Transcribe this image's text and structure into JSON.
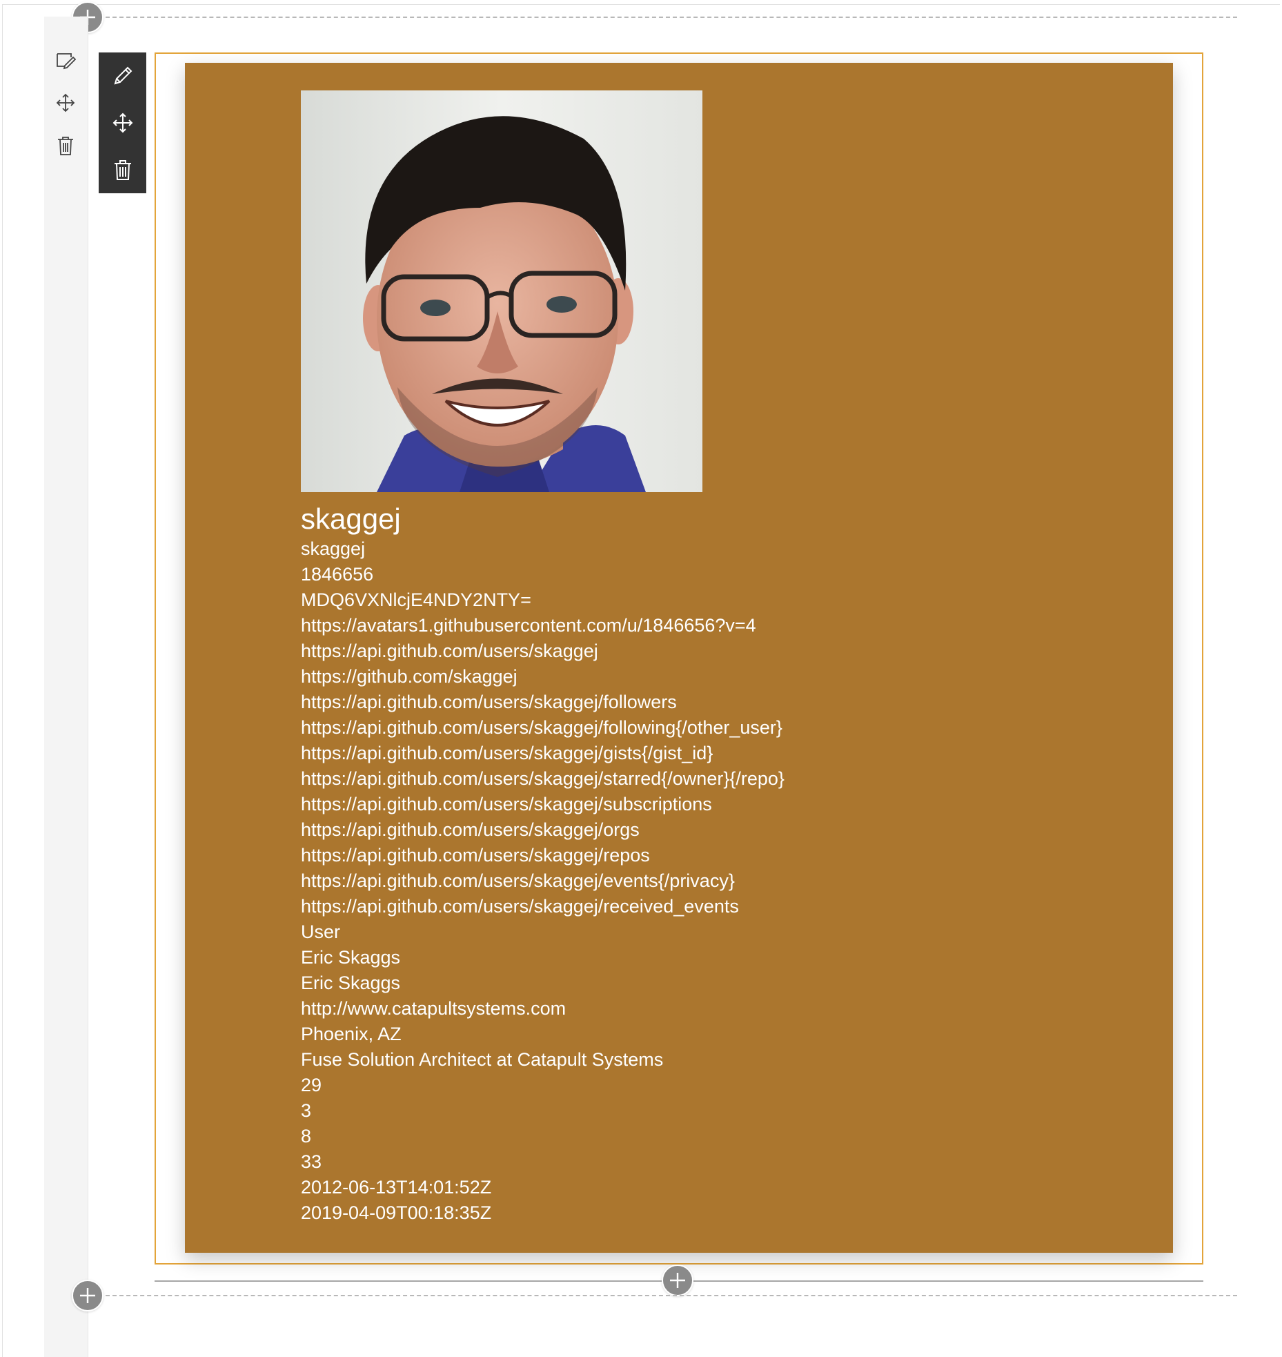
{
  "section_tools": {
    "edit_icon": "edit-section-icon",
    "move_icon": "move-section-icon",
    "delete_icon": "delete-section-icon"
  },
  "webpart_tools": {
    "edit_icon": "pencil-icon",
    "move_icon": "move-icon",
    "delete_icon": "trash-icon"
  },
  "profile": {
    "title": "skaggej",
    "fields": [
      "skaggej",
      "1846656",
      "MDQ6VXNlcjE4NDY2NTY=",
      "https://avatars1.githubusercontent.com/u/1846656?v=4",
      "https://api.github.com/users/skaggej",
      "https://github.com/skaggej",
      "https://api.github.com/users/skaggej/followers",
      "https://api.github.com/users/skaggej/following{/other_user}",
      "https://api.github.com/users/skaggej/gists{/gist_id}",
      "https://api.github.com/users/skaggej/starred{/owner}{/repo}",
      "https://api.github.com/users/skaggej/subscriptions",
      "https://api.github.com/users/skaggej/orgs",
      "https://api.github.com/users/skaggej/repos",
      "https://api.github.com/users/skaggej/events{/privacy}",
      "https://api.github.com/users/skaggej/received_events",
      "User",
      "Eric Skaggs",
      "Eric Skaggs",
      "http://www.catapultsystems.com",
      "Phoenix, AZ",
      "Fuse Solution Architect at Catapult Systems",
      "29",
      "3",
      "8",
      "33",
      "2012-06-13T14:01:52Z",
      "2019-04-09T00:18:35Z"
    ]
  },
  "colors": {
    "card_background": "#ab762e",
    "selection_border": "#e3a43a",
    "toolbar_background": "#333333"
  }
}
